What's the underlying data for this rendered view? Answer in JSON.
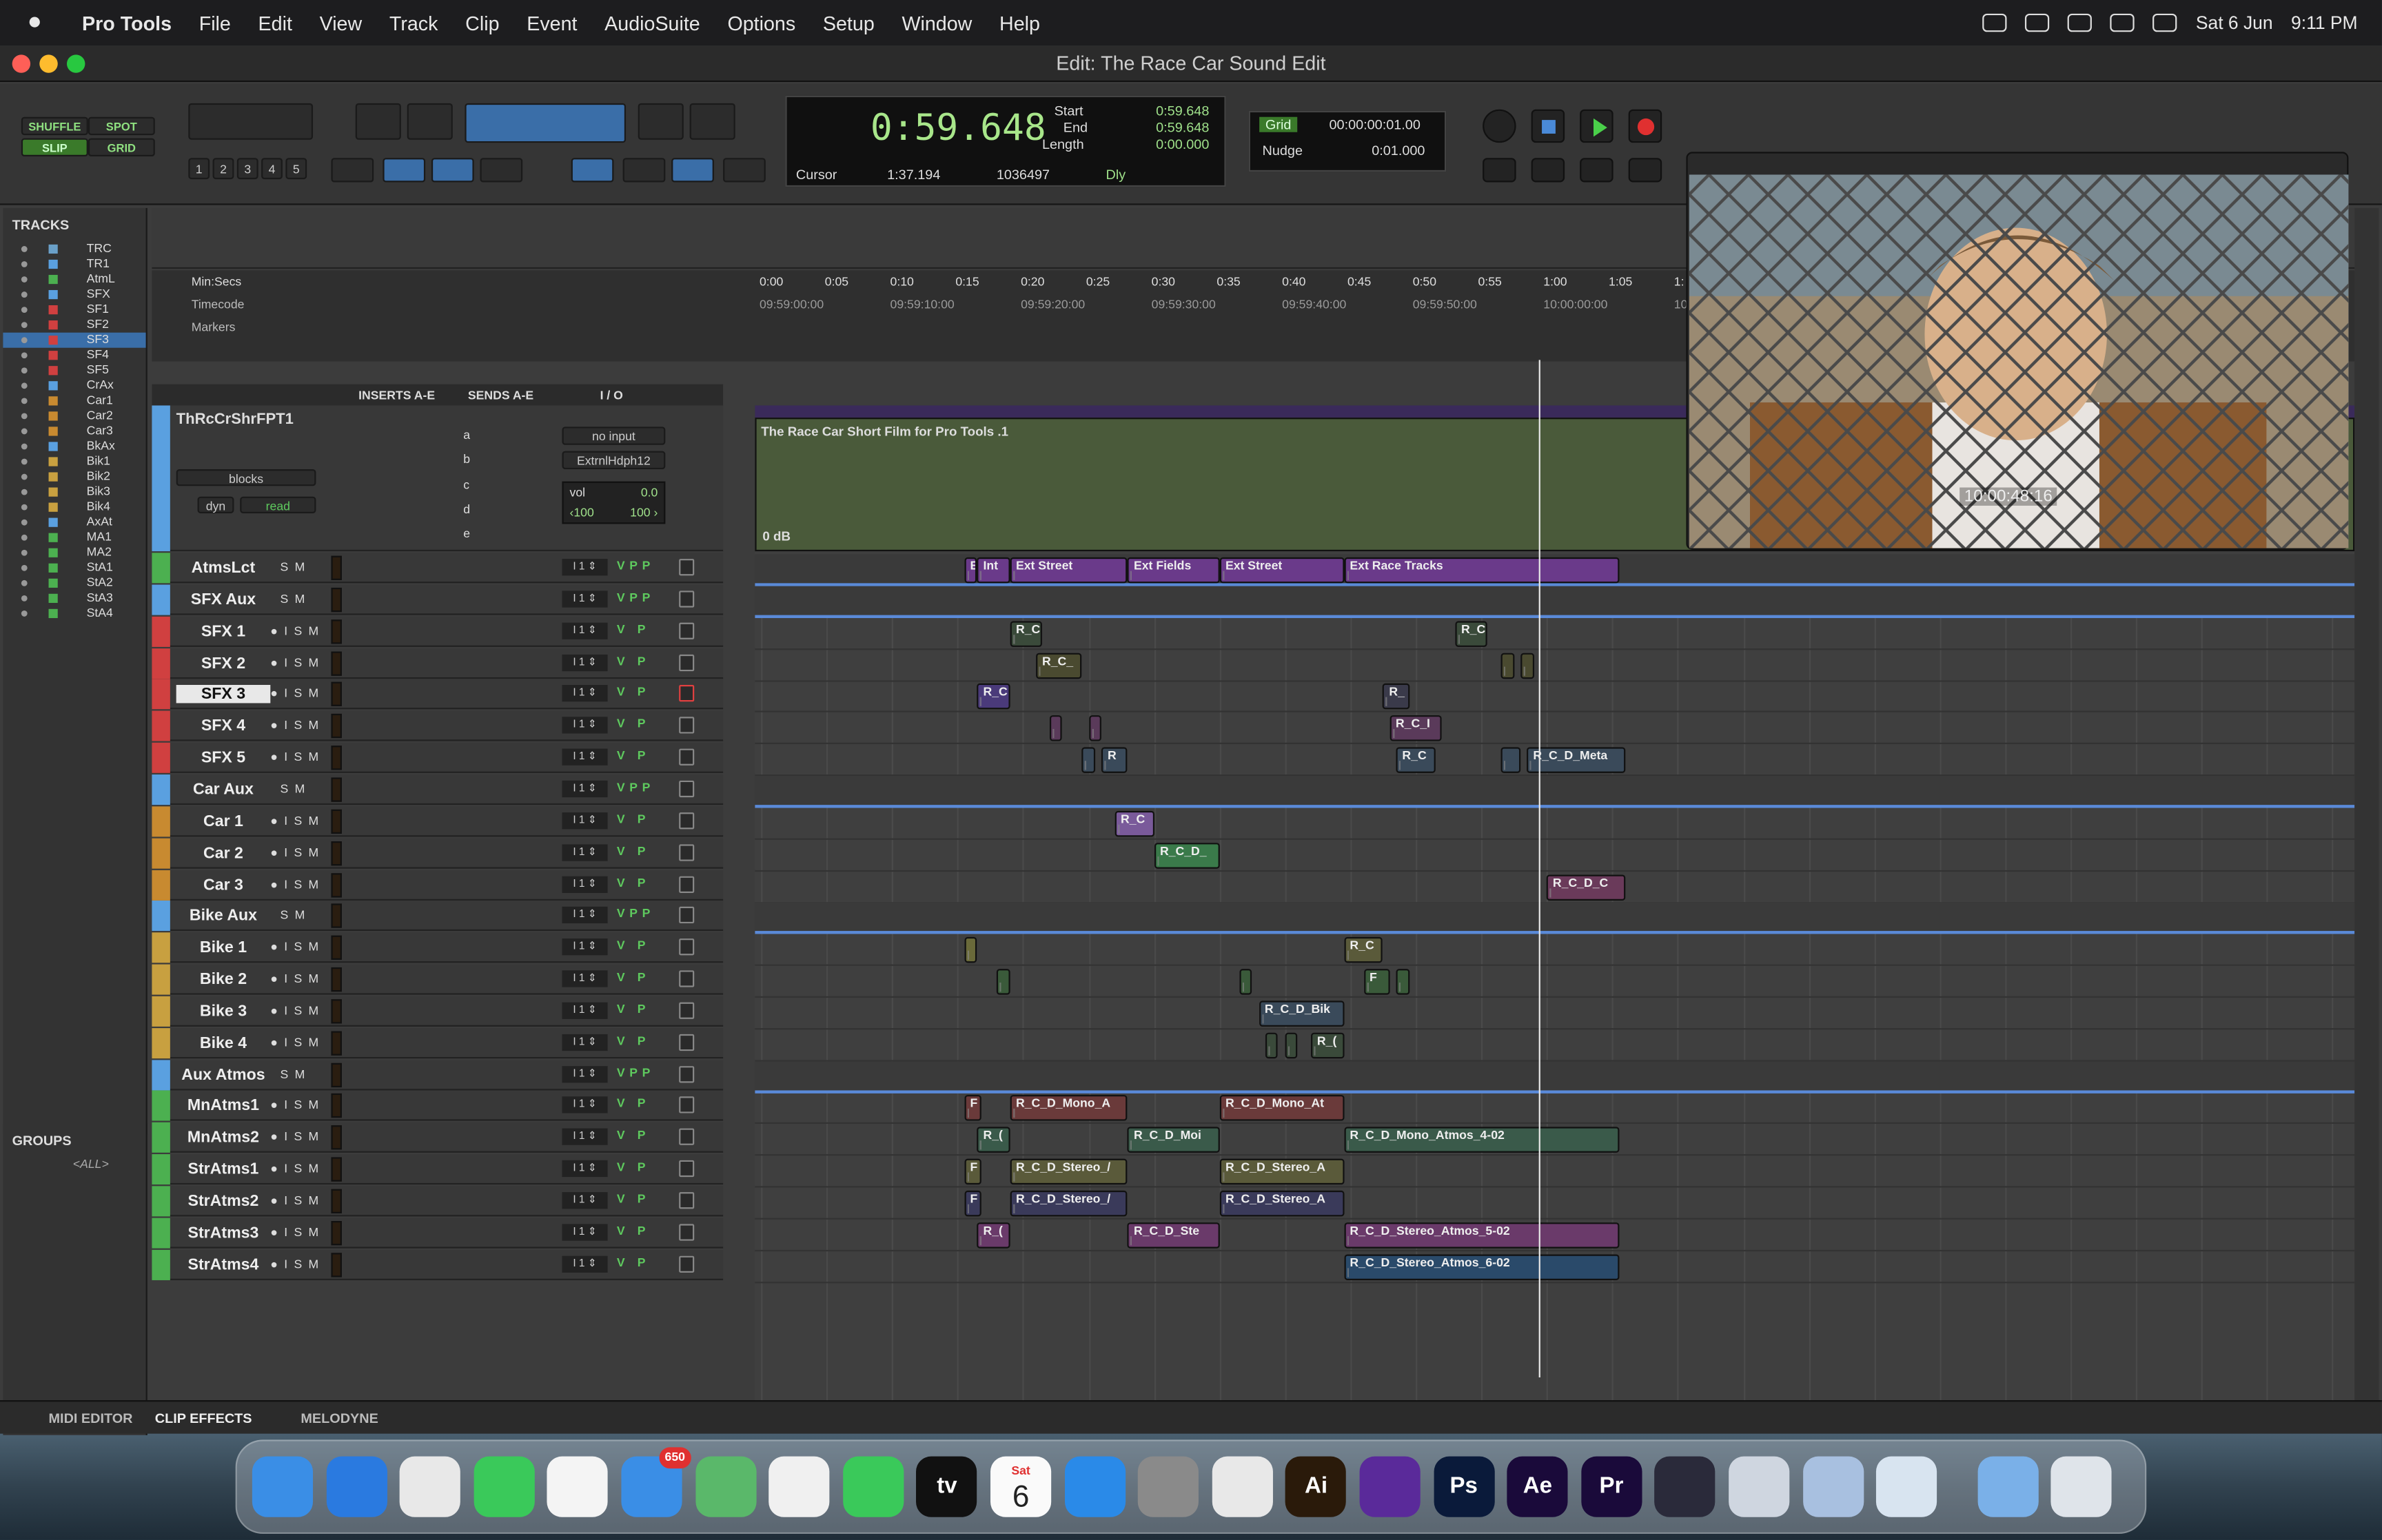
{
  "menubar": {
    "apple": "",
    "app": "Pro Tools",
    "items": [
      "File",
      "Edit",
      "View",
      "Track",
      "Clip",
      "Event",
      "AudioSuite",
      "Options",
      "Setup",
      "Window",
      "Help"
    ],
    "date": "Sat 6 Jun",
    "time": "9:11 PM"
  },
  "window": {
    "title": "Edit: The Race Car Sound Edit"
  },
  "modes": {
    "shuffle": "SHUFFLE",
    "spot": "SPOT",
    "slip": "SLIP",
    "grid": "GRID"
  },
  "zoom_presets": [
    "1",
    "2",
    "3",
    "4",
    "5"
  ],
  "counter": {
    "main": "0:59.648",
    "start_label": "Start",
    "end_label": "End",
    "length_label": "Length",
    "start": "0:59.648",
    "end": "0:59.648",
    "length": "0:00.000",
    "cursor_label": "Cursor",
    "cursor": "1:37.194",
    "samples": "1036497",
    "dly": "Dly"
  },
  "grid": {
    "grid_label": "Grid",
    "grid_value": "00:00:00:01.00",
    "nudge_label": "Nudge",
    "nudge_value": "0:01.000"
  },
  "tracks_panel": {
    "title": "TRACKS",
    "items": [
      {
        "name": "TRC",
        "color": "#6aa0c8"
      },
      {
        "name": "TR1",
        "color": "#5aa0e0"
      },
      {
        "name": "AtmL",
        "color": "#4cb050"
      },
      {
        "name": "SFX",
        "color": "#5aa0e0"
      },
      {
        "name": "SF1",
        "color": "#d04040"
      },
      {
        "name": "SF2",
        "color": "#d04040"
      },
      {
        "name": "SF3",
        "color": "#d04040"
      },
      {
        "name": "SF4",
        "color": "#d04040"
      },
      {
        "name": "SF5",
        "color": "#d04040"
      },
      {
        "name": "CrAx",
        "color": "#5aa0e0"
      },
      {
        "name": "Car1",
        "color": "#c88a30"
      },
      {
        "name": "Car2",
        "color": "#c88a30"
      },
      {
        "name": "Car3",
        "color": "#c88a30"
      },
      {
        "name": "BkAx",
        "color": "#5aa0e0"
      },
      {
        "name": "Bik1",
        "color": "#c8a040"
      },
      {
        "name": "Bik2",
        "color": "#c8a040"
      },
      {
        "name": "Bik3",
        "color": "#c8a040"
      },
      {
        "name": "Bik4",
        "color": "#c8a040"
      },
      {
        "name": "AxAt",
        "color": "#5aa0e0"
      },
      {
        "name": "MA1",
        "color": "#4cb050"
      },
      {
        "name": "MA2",
        "color": "#4cb050"
      },
      {
        "name": "StA1",
        "color": "#4cb050"
      },
      {
        "name": "StA2",
        "color": "#4cb050"
      },
      {
        "name": "StA3",
        "color": "#4cb050"
      },
      {
        "name": "StA4",
        "color": "#4cb050"
      }
    ]
  },
  "groups_panel": {
    "title": "GROUPS",
    "all": "<ALL>"
  },
  "rulers": {
    "minsecs": "Min:Secs",
    "timecode": "Timecode",
    "markers": "Markers",
    "ticks": [
      "0:00",
      "0:05",
      "0:10",
      "0:15",
      "0:20",
      "0:25",
      "0:30",
      "0:35",
      "0:40",
      "0:45",
      "0:50",
      "0:55",
      "1:00",
      "1:05",
      "1:"
    ],
    "tc": [
      "09:59:00:00",
      "09:59:10:00",
      "09:59:20:00",
      "09:59:30:00",
      "09:59:40:00",
      "09:59:50:00",
      "10:00:00:00",
      "10"
    ]
  },
  "columns": {
    "inserts": "INSERTS A-E",
    "sends": "SENDS A-E",
    "io": "I / O"
  },
  "video_track": {
    "name": "ThRcCrShrFPT1",
    "input": "no input",
    "output": "ExtrnlHdph12",
    "blocks": "blocks",
    "dyn": "dyn",
    "read": "read",
    "vol_label": "vol",
    "vol": "0.0",
    "pan_l": "‹100",
    "pan_r": "100 ›",
    "clip": "The Race Car Short Film for Pro Tools .1",
    "db": "0 dB",
    "sends": [
      "a",
      "b",
      "c",
      "d",
      "e"
    ]
  },
  "tracks": [
    {
      "name": "AtmsLct",
      "color": "#4cb050",
      "kind": "aux"
    },
    {
      "name": "SFX Aux",
      "color": "#5aa0e0",
      "kind": "aux"
    },
    {
      "name": "SFX 1",
      "color": "#d04040",
      "kind": "audio"
    },
    {
      "name": "SFX 2",
      "color": "#d04040",
      "kind": "audio"
    },
    {
      "name": "SFX 3",
      "color": "#d04040",
      "kind": "audio"
    },
    {
      "name": "SFX 4",
      "color": "#d04040",
      "kind": "audio"
    },
    {
      "name": "SFX 5",
      "color": "#d04040",
      "kind": "audio"
    },
    {
      "name": "Car Aux",
      "color": "#5aa0e0",
      "kind": "aux"
    },
    {
      "name": "Car 1",
      "color": "#c88a30",
      "kind": "audio"
    },
    {
      "name": "Car 2",
      "color": "#c88a30",
      "kind": "audio"
    },
    {
      "name": "Car 3",
      "color": "#c88a30",
      "kind": "audio"
    },
    {
      "name": "Bike Aux",
      "color": "#5aa0e0",
      "kind": "aux"
    },
    {
      "name": "Bike 1",
      "color": "#c8a040",
      "kind": "audio"
    },
    {
      "name": "Bike 2",
      "color": "#c8a040",
      "kind": "audio"
    },
    {
      "name": "Bike 3",
      "color": "#c8a040",
      "kind": "audio"
    },
    {
      "name": "Bike 4",
      "color": "#c8a040",
      "kind": "audio"
    },
    {
      "name": "Aux Atmos",
      "color": "#5aa0e0",
      "kind": "aux"
    },
    {
      "name": "MnAtms1",
      "color": "#4cb050",
      "kind": "audio"
    },
    {
      "name": "MnAtms2",
      "color": "#4cb050",
      "kind": "audio"
    },
    {
      "name": "StrAtms1",
      "color": "#4cb050",
      "kind": "audio"
    },
    {
      "name": "StrAtms2",
      "color": "#4cb050",
      "kind": "audio"
    },
    {
      "name": "StrAtms3",
      "color": "#4cb050",
      "kind": "audio"
    },
    {
      "name": "StrAtms4",
      "color": "#4cb050",
      "kind": "audio"
    }
  ],
  "clips": [
    {
      "lane": 0,
      "label": "E",
      "t0": 15.5,
      "t1": 16.5,
      "c": "#6a3a8a"
    },
    {
      "lane": 0,
      "label": "Int",
      "t0": 16.5,
      "t1": 19,
      "c": "#6a3a8a"
    },
    {
      "lane": 0,
      "label": "Ext Street",
      "t0": 19,
      "t1": 28,
      "c": "#6a3a8a"
    },
    {
      "lane": 0,
      "label": "Ext Fields",
      "t0": 28,
      "t1": 35,
      "c": "#6a3a8a"
    },
    {
      "lane": 0,
      "label": "Ext Street",
      "t0": 35,
      "t1": 44.5,
      "c": "#6a3a8a"
    },
    {
      "lane": 0,
      "label": "Ext Race Tracks",
      "t0": 44.5,
      "t1": 65.5,
      "c": "#6a3a8a"
    },
    {
      "lane": 2,
      "label": "R_C",
      "t0": 19,
      "t1": 21.5,
      "c": "#3a4a3a"
    },
    {
      "lane": 2,
      "label": "R_C",
      "t0": 53,
      "t1": 55.5,
      "c": "#3a4a3a"
    },
    {
      "lane": 3,
      "label": "R_C_",
      "t0": 21,
      "t1": 24.5,
      "c": "#4a4a30"
    },
    {
      "lane": 3,
      "label": "",
      "t0": 56.5,
      "t1": 57.5,
      "c": "#4a4a30"
    },
    {
      "lane": 3,
      "label": "",
      "t0": 58,
      "t1": 59,
      "c": "#4a4a30"
    },
    {
      "lane": 4,
      "label": "R_C",
      "t0": 16.5,
      "t1": 19,
      "c": "#4a3a7a"
    },
    {
      "lane": 4,
      "label": "R_",
      "t0": 47.5,
      "t1": 49.5,
      "c": "#3a3a4a"
    },
    {
      "lane": 5,
      "label": "",
      "t0": 22,
      "t1": 23,
      "c": "#5a3a5a"
    },
    {
      "lane": 5,
      "label": "",
      "t0": 25,
      "t1": 26,
      "c": "#5a3a5a"
    },
    {
      "lane": 5,
      "label": "R_C_I",
      "t0": 48,
      "t1": 52,
      "c": "#5a3a5a"
    },
    {
      "lane": 6,
      "label": "",
      "t0": 24.5,
      "t1": 25.5,
      "c": "#3a4a5a"
    },
    {
      "lane": 6,
      "label": "R",
      "t0": 26,
      "t1": 28,
      "c": "#3a4a5a"
    },
    {
      "lane": 6,
      "label": "R_C",
      "t0": 48.5,
      "t1": 51.5,
      "c": "#3a4a5a"
    },
    {
      "lane": 6,
      "label": "",
      "t0": 56.5,
      "t1": 58,
      "c": "#3a4a5a"
    },
    {
      "lane": 6,
      "label": "R_C_D_Meta",
      "t0": 58.5,
      "t1": 66,
      "c": "#3a4a5a"
    },
    {
      "lane": 8,
      "label": "R_C",
      "t0": 27,
      "t1": 30,
      "c": "#7a5a9a"
    },
    {
      "lane": 9,
      "label": "R_C_D_",
      "t0": 30,
      "t1": 35,
      "c": "#3a7a4a"
    },
    {
      "lane": 10,
      "label": "R_C_D_C",
      "t0": 60,
      "t1": 66,
      "c": "#6a3a5a"
    },
    {
      "lane": 12,
      "label": "",
      "t0": 15.5,
      "t1": 16.5,
      "c": "#6a6a3a"
    },
    {
      "lane": 12,
      "label": "R_C",
      "t0": 44.5,
      "t1": 47.5,
      "c": "#5a5a3a"
    },
    {
      "lane": 13,
      "label": "",
      "t0": 18,
      "t1": 19,
      "c": "#3a5a3a"
    },
    {
      "lane": 13,
      "label": "",
      "t0": 36.5,
      "t1": 37.5,
      "c": "#3a5a3a"
    },
    {
      "lane": 13,
      "label": "F",
      "t0": 46,
      "t1": 48,
      "c": "#3a5a3a"
    },
    {
      "lane": 13,
      "label": "",
      "t0": 48.5,
      "t1": 49.5,
      "c": "#3a5a3a"
    },
    {
      "lane": 14,
      "label": "R_C_D_Bik",
      "t0": 38,
      "t1": 44.5,
      "c": "#3a4a5a"
    },
    {
      "lane": 15,
      "label": "",
      "t0": 38.5,
      "t1": 39.5,
      "c": "#3a4a3a"
    },
    {
      "lane": 15,
      "label": "",
      "t0": 40,
      "t1": 41,
      "c": "#3a4a3a"
    },
    {
      "lane": 15,
      "label": "R_(",
      "t0": 42,
      "t1": 44.5,
      "c": "#3a4a3a"
    },
    {
      "lane": 17,
      "label": "F",
      "t0": 15.5,
      "t1": 16.8,
      "c": "#6a3a3a"
    },
    {
      "lane": 17,
      "label": "R_C_D_Mono_A",
      "t0": 19,
      "t1": 28,
      "c": "#6a3a3a"
    },
    {
      "lane": 17,
      "label": "R_C_D_Mono_At",
      "t0": 35,
      "t1": 44.5,
      "c": "#6a3a3a"
    },
    {
      "lane": 18,
      "label": "R_(",
      "t0": 16.5,
      "t1": 19,
      "c": "#3a5a4a"
    },
    {
      "lane": 18,
      "label": "R_C_D_Moi",
      "t0": 28,
      "t1": 35,
      "c": "#3a5a4a"
    },
    {
      "lane": 18,
      "label": "R_C_D_Mono_Atmos_4-02",
      "t0": 44.5,
      "t1": 65.5,
      "c": "#3a5a4a"
    },
    {
      "lane": 19,
      "label": "F",
      "t0": 15.5,
      "t1": 16.8,
      "c": "#5a5a3a"
    },
    {
      "lane": 19,
      "label": "R_C_D_Stereo_/",
      "t0": 19,
      "t1": 28,
      "c": "#5a5a3a"
    },
    {
      "lane": 19,
      "label": "R_C_D_Stereo_A",
      "t0": 35,
      "t1": 44.5,
      "c": "#5a5a3a"
    },
    {
      "lane": 20,
      "label": "F",
      "t0": 15.5,
      "t1": 16.8,
      "c": "#3a3a5a"
    },
    {
      "lane": 20,
      "label": "R_C_D_Stereo_/",
      "t0": 19,
      "t1": 28,
      "c": "#3a3a5a"
    },
    {
      "lane": 20,
      "label": "R_C_D_Stereo_A",
      "t0": 35,
      "t1": 44.5,
      "c": "#3a3a5a"
    },
    {
      "lane": 21,
      "label": "R_(",
      "t0": 16.5,
      "t1": 19,
      "c": "#6a3a6a"
    },
    {
      "lane": 21,
      "label": "R_C_D_Ste",
      "t0": 28,
      "t1": 35,
      "c": "#6a3a6a"
    },
    {
      "lane": 21,
      "label": "R_C_D_Stereo_Atmos_5-02",
      "t0": 44.5,
      "t1": 65.5,
      "c": "#6a3a6a"
    },
    {
      "lane": 22,
      "label": "R_C_D_Stereo_Atmos_6-02",
      "t0": 44.5,
      "t1": 65.5,
      "c": "#2a4a6a"
    }
  ],
  "video": {
    "timecode": "10:00:48:16"
  },
  "bottombar": {
    "midi": "MIDI EDITOR",
    "clipfx": "CLIP EFFECTS",
    "melodyne": "MELODYNE"
  },
  "dock": {
    "badge": "650",
    "calendar_day": "Sat",
    "calendar_date": "6",
    "apps": [
      {
        "name": "Finder",
        "label": "",
        "c": "#3a8ee6"
      },
      {
        "name": "Safari",
        "label": "",
        "c": "#2a7ae0"
      },
      {
        "name": "Chrome",
        "label": "",
        "c": "#e8e8e8"
      },
      {
        "name": "Messages",
        "label": "",
        "c": "#3ac95a"
      },
      {
        "name": "Reminders",
        "label": "",
        "c": "#f4f4f4"
      },
      {
        "name": "Mail",
        "label": "",
        "c": "#3a8ee6"
      },
      {
        "name": "Maps",
        "label": "",
        "c": "#5ab86a"
      },
      {
        "name": "Photos",
        "label": "",
        "c": "#f0f0f0"
      },
      {
        "name": "FaceTime",
        "label": "",
        "c": "#3ac95a"
      },
      {
        "name": "TV",
        "label": "tv",
        "c": "#111"
      },
      {
        "name": "Calendar",
        "label": "",
        "c": "#fafafa"
      },
      {
        "name": "App Store",
        "label": "",
        "c": "#2a8ae8"
      },
      {
        "name": "Settings",
        "label": "",
        "c": "#8a8a8a"
      },
      {
        "name": "Blender",
        "label": "",
        "c": "#e8e8e8"
      },
      {
        "name": "Illustrator",
        "label": "Ai",
        "c": "#2a1a0a"
      },
      {
        "name": "Pro Tools",
        "label": "",
        "c": "#5a2a9a"
      },
      {
        "name": "Photoshop",
        "label": "Ps",
        "c": "#0a1a3a"
      },
      {
        "name": "After Effects",
        "label": "Ae",
        "c": "#1a0a3a"
      },
      {
        "name": "Premiere",
        "label": "Pr",
        "c": "#1a0a3a"
      },
      {
        "name": "DaVinci",
        "label": "",
        "c": "#2a2a3a"
      },
      {
        "name": "Automator",
        "label": "",
        "c": "#cfd6e0"
      },
      {
        "name": "Utility",
        "label": "",
        "c": "#a8c0e0"
      },
      {
        "name": "QuickTime",
        "label": "",
        "c": "#d8e4f0"
      },
      {
        "name": "Folder",
        "label": "",
        "c": "#7ab0e8"
      },
      {
        "name": "Trash",
        "label": "",
        "c": "#dfe4ea"
      }
    ]
  }
}
